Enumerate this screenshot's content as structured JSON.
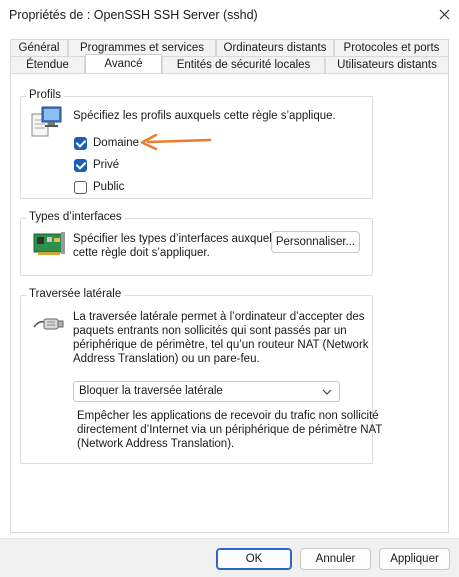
{
  "window": {
    "title": "Propriétés de : OpenSSH SSH Server (sshd)"
  },
  "tabs_row1": [
    "Général",
    "Programmes et services",
    "Ordinateurs distants",
    "Protocoles et ports"
  ],
  "tabs_row2": [
    "Étendue",
    "Avancé",
    "Entités de sécurité locales",
    "Utilisateurs distants"
  ],
  "active_tab": "Avancé",
  "profiles": {
    "title": "Profils",
    "description": "Spécifiez les profils auxquels cette règle s’applique.",
    "items": [
      {
        "label": "Domaine",
        "checked": true
      },
      {
        "label": "Privé",
        "checked": true
      },
      {
        "label": "Public",
        "checked": false
      }
    ]
  },
  "interfaces": {
    "title": "Types d’interfaces",
    "line1": "Spécifier les types d’interfaces auxquels",
    "line2": "cette règle doit s’appliquer.",
    "button": "Personnaliser..."
  },
  "traversal": {
    "title": "Traversée latérale",
    "desc_lines": [
      "La traversée latérale permet à l’ordinateur d’accepter des",
      "paquets entrants non sollicités qui sont passés par un",
      "périphérique de périmètre, tel qu’un routeur NAT (Network",
      "Address Translation) ou un pare-feu."
    ],
    "select_value": "Bloquer la traversée latérale",
    "help_lines": [
      "Empêcher les applications de recevoir du trafic non sollicité",
      "directement d’Internet via un périphérique de périmètre NAT",
      "(Network Address Translation)."
    ]
  },
  "footer": {
    "ok": "OK",
    "cancel": "Annuler",
    "apply": "Appliquer"
  },
  "colors": {
    "accent": "#1a5fb4",
    "arrow": "#f07b2c"
  },
  "icons": [
    "close-icon",
    "monitor-icon",
    "network-card-icon",
    "cable-plug-icon",
    "chevron-down-icon",
    "annotation-arrow"
  ]
}
